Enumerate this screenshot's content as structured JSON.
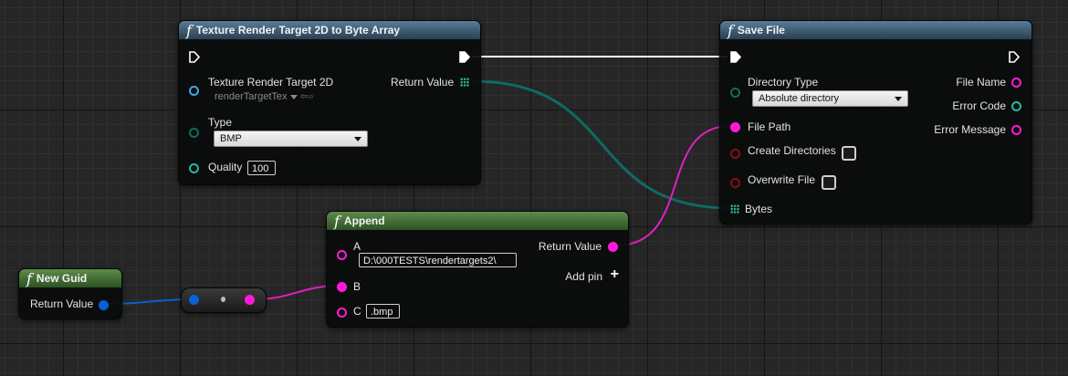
{
  "nodes": {
    "texture_to_bytes": {
      "title": "Texture Render Target 2D to Byte Array",
      "input_texture_label": "Texture Render Target 2D",
      "input_texture_value": "renderTargetTex",
      "type_label": "Type",
      "type_value": "BMP",
      "quality_label": "Quality",
      "quality_value": "100",
      "return_label": "Return Value"
    },
    "save_file": {
      "title": "Save File",
      "directory_type_label": "Directory Type",
      "directory_type_value": "Absolute directory",
      "file_path_label": "File Path",
      "create_dirs_label": "Create Directories",
      "overwrite_label": "Overwrite File",
      "bytes_label": "Bytes",
      "file_name_label": "File Name",
      "error_code_label": "Error Code",
      "error_message_label": "Error Message"
    },
    "append": {
      "title": "Append",
      "a_label": "A",
      "a_value": "D:\\000TESTS\\rendertargets2\\",
      "b_label": "B",
      "c_label": "C",
      "c_value": ".bmp",
      "return_label": "Return Value",
      "add_pin_label": "Add pin"
    },
    "new_guid": {
      "title": "New Guid",
      "return_label": "Return Value"
    }
  },
  "colors": {
    "exec_wire": "#ffffff",
    "byte_wire": "#0e6b63",
    "string_wire": "#e020c0",
    "guid_wire": "#0a5fd0",
    "pin_teal": "#2bb5a0",
    "pin_magenta": "#ff1ad9",
    "pin_darkred": "#8a0e0e",
    "pin_cyan": "#3fa6e6",
    "pin_darkteal": "#0d6e5e",
    "pin_blue": "#0b5fd6"
  },
  "icons": [
    "function-icon",
    "exec-pin-icon",
    "object-pin-icon",
    "byte-array-pin-icon",
    "add-pin-icon",
    "asset-browse-icon",
    "asset-search-icon",
    "dropdown-arrow-icon",
    "checkbox-icon"
  ]
}
